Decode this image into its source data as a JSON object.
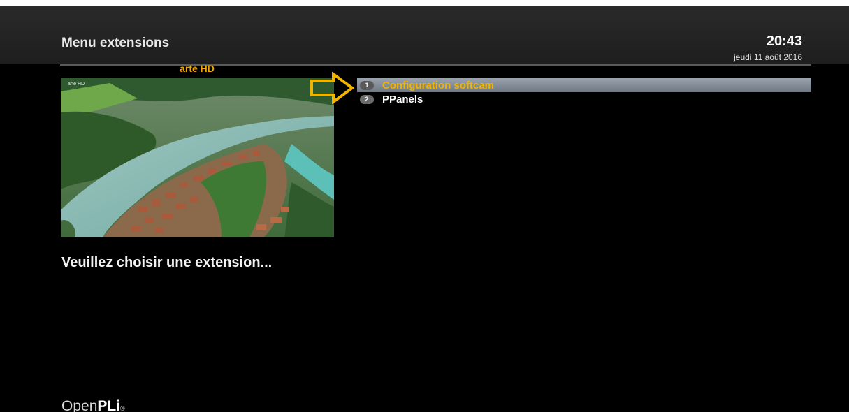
{
  "header": {
    "title": "Menu extensions",
    "clock": "20:43",
    "date": "jeudi 11 août 2016"
  },
  "preview": {
    "channel_name": "arte HD",
    "watermark": "arte HD"
  },
  "menu": {
    "items": [
      {
        "number": "1",
        "label": "Configuration softcam",
        "selected": true
      },
      {
        "number": "2",
        "label": "PPanels",
        "selected": false
      }
    ]
  },
  "hint": "Veuillez choisir une extension...",
  "brand": {
    "logo_light": "Open",
    "logo_bold": "PLi",
    "logo_mark": "®"
  },
  "colors": {
    "accent": "#f0b400",
    "background": "#000000",
    "selection": "#8a939c"
  }
}
